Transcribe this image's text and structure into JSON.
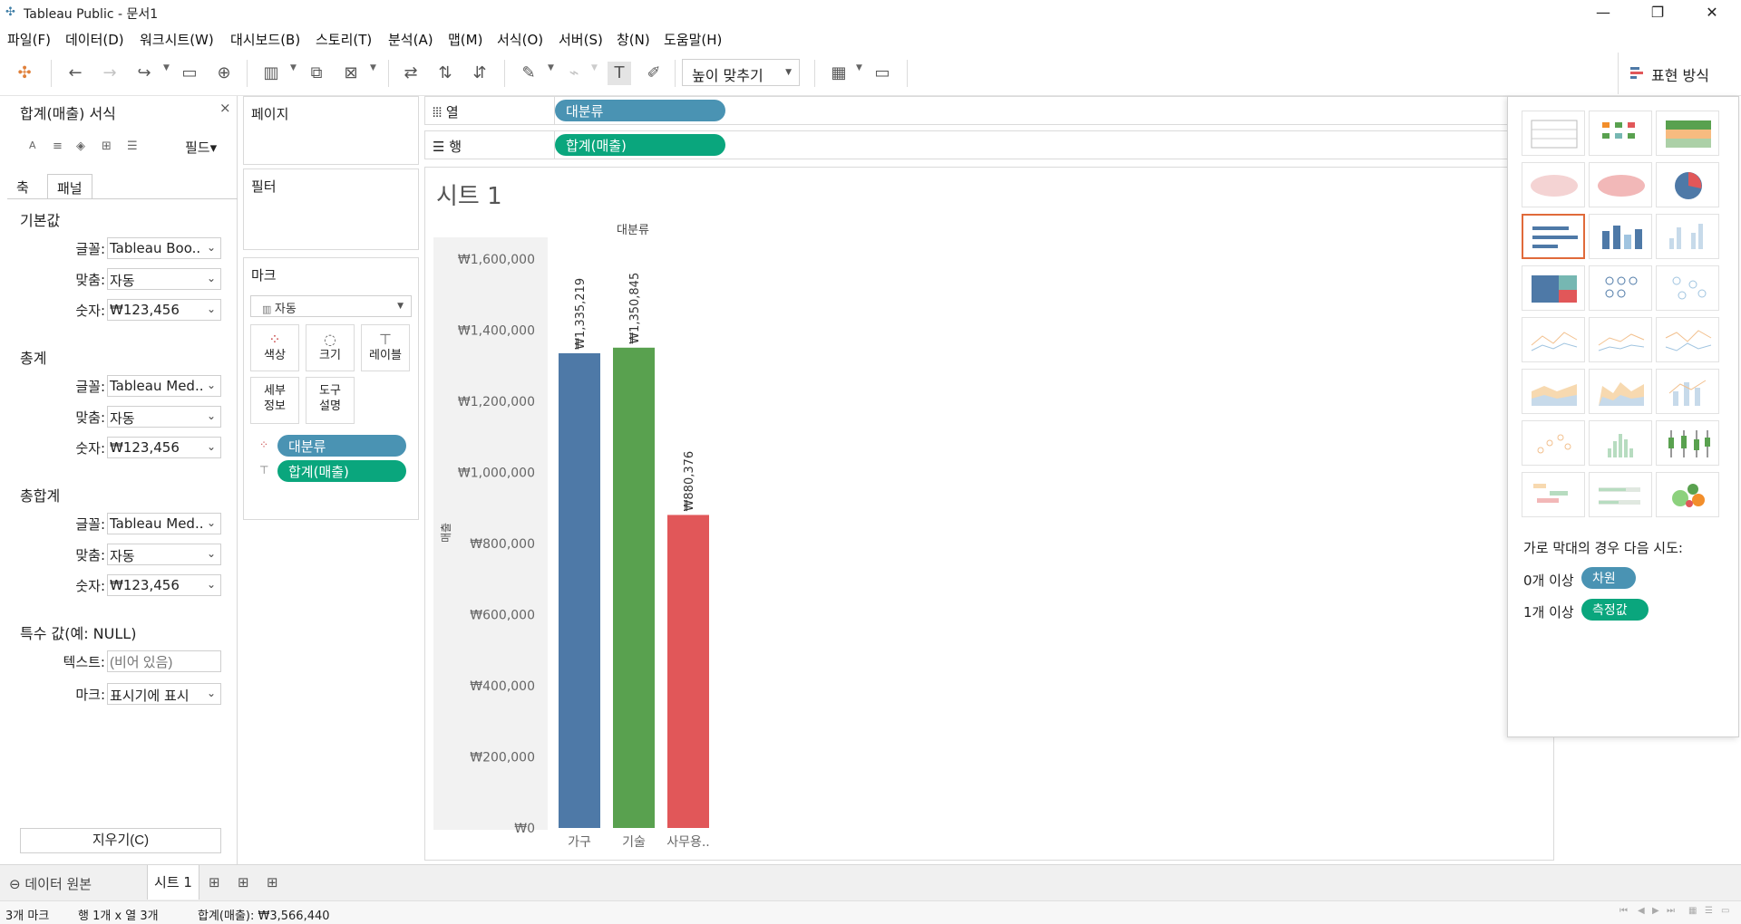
{
  "window": {
    "title": "Tableau Public - 문서1",
    "minimize": "—",
    "restore": "❐",
    "close": "✕"
  },
  "menu": [
    "파일(F)",
    "데이터(D)",
    "워크시트(W)",
    "대시보드(B)",
    "스토리(T)",
    "분석(A)",
    "맵(M)",
    "서식(O)",
    "서버(S)",
    "창(N)",
    "도움말(H)"
  ],
  "toolbar": {
    "fit_select": "높이 맞추기",
    "show_me_label": "표현 방식"
  },
  "format_pane": {
    "title": "합계(매출) 서식",
    "close": "×",
    "field_dropdown": "필드▾",
    "tabs": [
      "축",
      "패널"
    ],
    "sections": [
      {
        "title": "기본값",
        "rows": [
          {
            "label": "글꼴:",
            "value": "Tableau Boo.."
          },
          {
            "label": "맞춤:",
            "value": "자동"
          },
          {
            "label": "숫자:",
            "value": "₩123,456"
          }
        ]
      },
      {
        "title": "총계",
        "rows": [
          {
            "label": "글꼴:",
            "value": "Tableau Med.."
          },
          {
            "label": "맞춤:",
            "value": "자동"
          },
          {
            "label": "숫자:",
            "value": "₩123,456"
          }
        ]
      },
      {
        "title": "총합계",
        "rows": [
          {
            "label": "글꼴:",
            "value": "Tableau Med.."
          },
          {
            "label": "맞춤:",
            "value": "자동"
          },
          {
            "label": "숫자:",
            "value": "₩123,456"
          }
        ]
      }
    ],
    "special": {
      "title": "특수 값(예: NULL)",
      "text_label": "텍스트:",
      "text_placeholder": "(비어 있음)",
      "mark_label": "마크:",
      "mark_value": "표시기에 표시"
    },
    "clear_button": "지우기(C)"
  },
  "shelves": {
    "pages": "페이지",
    "filters": "필터",
    "marks": "마크",
    "mark_type": "자동",
    "mark_buttons": [
      "색상",
      "크기",
      "레이블",
      "세부\n정보",
      "도구\n설명"
    ],
    "mark_pills": [
      "대분류",
      "합계(매출)"
    ],
    "columns_label": "열",
    "rows_label": "행",
    "columns_pill": "대분류",
    "rows_pill": "합계(매출)"
  },
  "sheet": {
    "title": "시트 1"
  },
  "chart_data": {
    "type": "bar",
    "title": "",
    "header": "대분류",
    "ylabel": "매출",
    "xlabel": "",
    "categories": [
      "가구",
      "기술",
      "사무용.."
    ],
    "values": [
      1335219,
      1350845,
      880376
    ],
    "data_labels": [
      "₩1,335,219",
      "₩1,350,845",
      "₩880,376"
    ],
    "colors": [
      "#4e79a7",
      "#59a14f",
      "#e15759"
    ],
    "ylim": [
      0,
      1600000
    ],
    "yticks": [
      0,
      200000,
      400000,
      600000,
      800000,
      1000000,
      1200000,
      1400000,
      1600000
    ],
    "ytick_labels": [
      "₩0",
      "₩200,000",
      "₩400,000",
      "₩600,000",
      "₩800,000",
      "₩1,000,000",
      "₩1,200,000",
      "₩1,400,000",
      "₩1,600,000"
    ],
    "grid": false
  },
  "show_me": {
    "hint": "가로 막대의 경우 다음 시도:",
    "req_dim": {
      "count": "0개 이상",
      "pill": "차원"
    },
    "req_mea": {
      "count": "1개 이상",
      "pill": "측정값"
    },
    "selected_index": 6,
    "chart_types": [
      "text-table",
      "heat-map",
      "highlight-table",
      "symbol-map",
      "filled-map",
      "pie-chart",
      "horizontal-bars",
      "stacked-bars",
      "side-by-side-bars",
      "treemap",
      "circle-views",
      "side-by-side-circles",
      "continuous-lines",
      "discrete-lines",
      "dual-lines",
      "area-continuous",
      "area-discrete",
      "dual-combination",
      "scatter-plot",
      "histogram",
      "box-and-whisker",
      "gantt-chart",
      "bullet-graph",
      "packed-bubbles"
    ]
  },
  "tabs": {
    "data_source": "데이터 원본",
    "sheet": "시트 1"
  },
  "status": {
    "marks": "3개 마크",
    "rows_cols": "행 1개 x 열 3개",
    "sum": "합계(매출): ₩3,566,440"
  },
  "colors": {
    "dimension_pill": "#4a93b3",
    "measure_pill": "#0aa67d",
    "selected_border": "#e06a3a"
  }
}
